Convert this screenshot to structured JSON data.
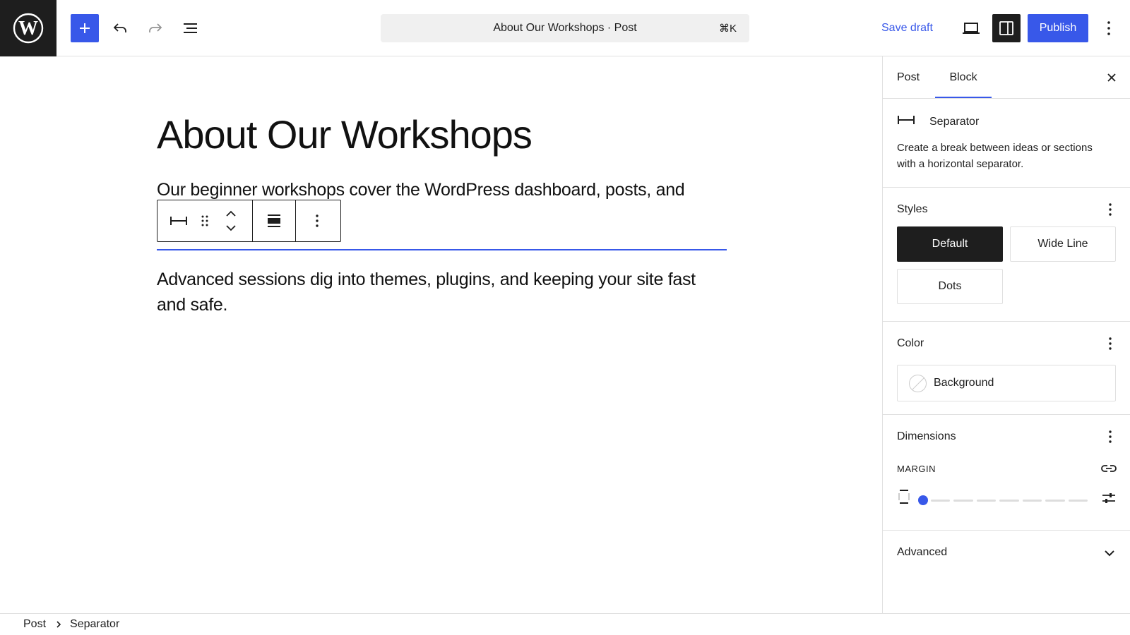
{
  "topbar": {
    "document_title": "About Our Workshops · Post",
    "shortcut": "⌘K",
    "save_draft": "Save draft",
    "publish": "Publish"
  },
  "editor": {
    "title": "About Our Workshops",
    "paragraph1": "Our beginner workshops cover the WordPress dashboard, posts, and",
    "paragraph2": "Advanced sessions dig into themes, plugins, and keeping your site fast and safe."
  },
  "sidebar": {
    "tabs": [
      {
        "label": "Post"
      },
      {
        "label": "Block"
      }
    ],
    "active_tab": "Block",
    "block": {
      "name": "Separator",
      "description": "Create a break between ideas or sections with a horizontal separator."
    },
    "styles": {
      "title": "Styles",
      "options": [
        "Default",
        "Wide Line",
        "Dots"
      ],
      "selected": "Default"
    },
    "color": {
      "title": "Color",
      "background_label": "Background"
    },
    "dimensions": {
      "title": "Dimensions",
      "margin_label": "MARGIN",
      "margin_value": 0
    },
    "advanced": {
      "title": "Advanced"
    }
  },
  "breadcrumb": {
    "items": [
      "Post",
      "Separator"
    ]
  },
  "colors": {
    "accent": "#3858e9",
    "dark": "#1e1e1e",
    "border": "#e0e0e0"
  }
}
